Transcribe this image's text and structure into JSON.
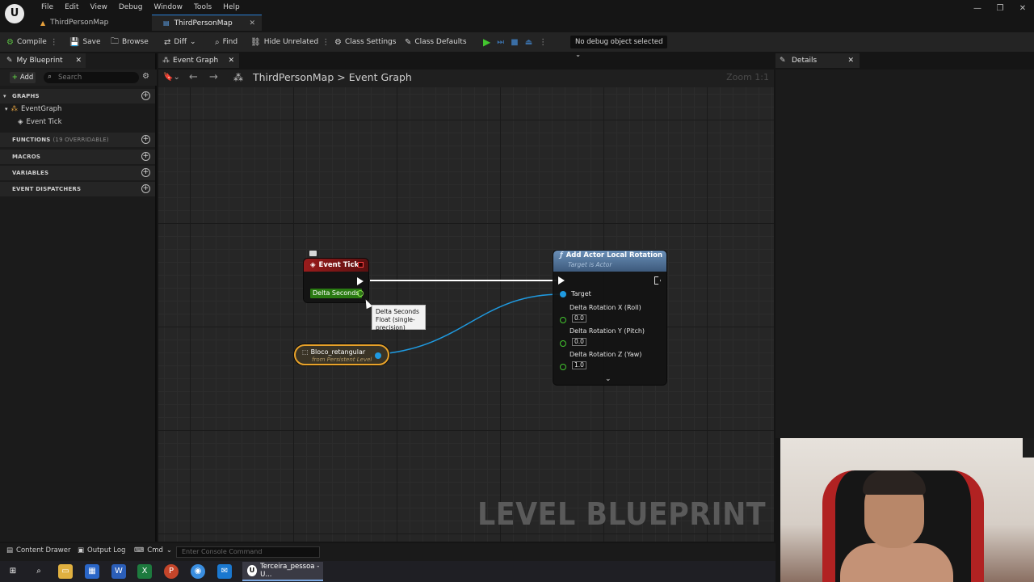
{
  "menubar": {
    "logo": "U",
    "items": [
      "File",
      "Edit",
      "View",
      "Debug",
      "Window",
      "Tools",
      "Help"
    ]
  },
  "doc_tabs": [
    {
      "label": "ThirdPersonMap"
    },
    {
      "label": "ThirdPersonMap"
    }
  ],
  "toolbar": {
    "compile": "Compile",
    "save": "Save",
    "browse": "Browse",
    "diff": "Diff",
    "find": "Find",
    "hide_unrelated": "Hide Unrelated",
    "class_settings": "Class Settings",
    "class_defaults": "Class Defaults",
    "debug_object": "No debug object selected"
  },
  "my_blueprint": {
    "tab": "My Blueprint",
    "add": "Add",
    "search_placeholder": "Search",
    "sections": {
      "graphs": "GRAPHS",
      "functions": "FUNCTIONS",
      "functions_sub": "(19 OVERRIDABLE)",
      "macros": "MACROS",
      "variables": "VARIABLES",
      "event_dispatchers": "EVENT DISPATCHERS"
    },
    "tree": {
      "event_graph": "EventGraph",
      "event_tick": "Event Tick"
    }
  },
  "graph": {
    "tab": "Event Graph",
    "breadcrumb_level": "ThirdPersonMap",
    "breadcrumb_sep": ">",
    "breadcrumb_graph": "Event Graph",
    "zoom": "Zoom 1:1",
    "watermark": "LEVEL BLUEPRINT",
    "node_event_tick": {
      "title": "Event Tick",
      "output_pin": "Delta Seconds"
    },
    "tooltip": {
      "line1": "Delta Seconds",
      "line2": "Float (single-precision)"
    },
    "node_add_rotation": {
      "title": "Add Actor Local Rotation",
      "subtitle": "Target is Actor",
      "target": "Target",
      "pins": [
        {
          "label": "Delta Rotation X (Roll)",
          "value": "0.0"
        },
        {
          "label": "Delta Rotation Y (Pitch)",
          "value": "0.0"
        },
        {
          "label": "Delta Rotation Z (Yaw)",
          "value": "1.0"
        }
      ]
    },
    "node_bloco": {
      "title": "Bloco_retangular",
      "subtitle": "from Persistent Level"
    }
  },
  "details": {
    "tab": "Details"
  },
  "bottombar": {
    "content_drawer": "Content Drawer",
    "output_log": "Output Log",
    "cmd": "Cmd",
    "console_placeholder": "Enter Console Command"
  },
  "taskbar": {
    "active_app": "Terceira_pessoa - U..."
  },
  "colors": {
    "exec_wire": "#ffffff",
    "object_wire": "#1f9ae0",
    "float_pin": "#43c62f",
    "event_header": "#9a1c1c",
    "function_header": "#6a8fb8",
    "selection": "#e8a22a"
  }
}
